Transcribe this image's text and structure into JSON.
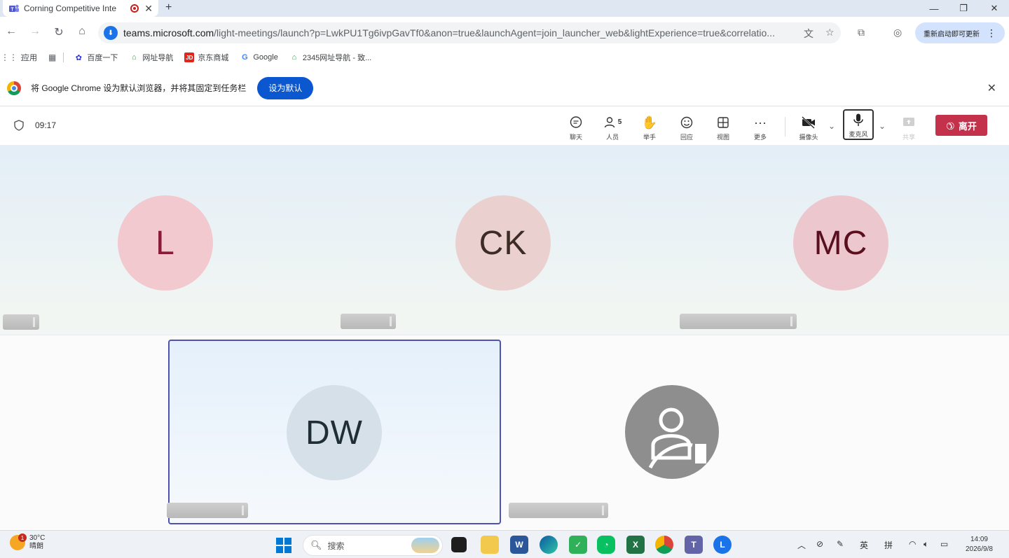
{
  "browser": {
    "tab_title": "Corning Competitive Inte",
    "url_host": "teams.microsoft.com",
    "url_rest": "/light-meetings/launch?p=LwkPU1Tg6ivpGavTf0&anon=true&launchAgent=join_launcher_web&lightExperience=true&correlatio...",
    "update_label": "重新启动即可更新",
    "bookmarks": [
      {
        "label": "应用",
        "icon": "apps-grid-icon"
      },
      {
        "label": "百度一下",
        "icon": "baidu-paw-icon"
      },
      {
        "label": "网址导航",
        "icon": "nav-house-icon"
      },
      {
        "label": "京东商城",
        "icon": "jd-icon"
      },
      {
        "label": "Google",
        "icon": "google-g-icon"
      },
      {
        "label": "2345网址导航 - 致...",
        "icon": "nav-house-icon"
      }
    ],
    "banner_text": "将 Google Chrome 设为默认浏览器，并将其固定到任务栏",
    "banner_button": "设为默认"
  },
  "meeting": {
    "elapsed": "09:17",
    "controls": {
      "chat": "聊天",
      "people": "人员",
      "people_count": "5",
      "raise_hand": "举手",
      "react": "回应",
      "view": "视图",
      "more": "更多",
      "camera": "摄像头",
      "mic": "麦克风",
      "share": "共享",
      "leave": "离开"
    },
    "participants": [
      {
        "initials": "L",
        "bg": "#f3c9d0",
        "fg": "#8a1a3a"
      },
      {
        "initials": "CK",
        "bg": "#ead1cf",
        "fg": "#3d2b26"
      },
      {
        "initials": "MC",
        "bg": "#ecc7cd",
        "fg": "#5a0f1e"
      },
      {
        "initials": "DW",
        "bg": "#d6e0e8",
        "fg": "#1f2d36"
      }
    ]
  },
  "taskbar": {
    "weather_temp": "30°C",
    "weather_desc": "晴朗",
    "weather_badge": "1",
    "search_placeholder": "搜索",
    "ime_lang": "英",
    "ime_mode": "拼",
    "time": "14:09",
    "date": "2026/9/8"
  },
  "colors": {
    "accent": "#4f52b2",
    "leave": "#c4314b",
    "chrome_blue": "#0b57d0"
  }
}
